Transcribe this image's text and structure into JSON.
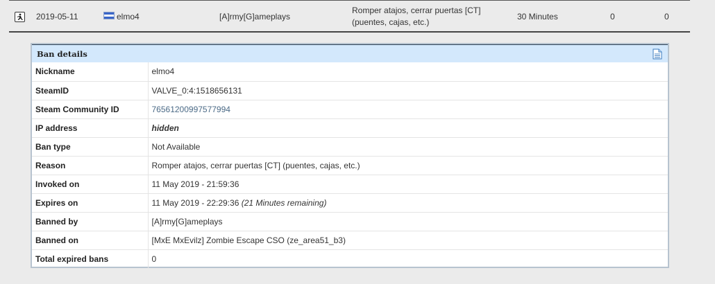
{
  "summary": {
    "date": "2019-05-11",
    "nickname": "elmo4",
    "admin": "[A]rmy[G]ameplays",
    "reason": "Romper atajos, cerrar puertas [CT] (puentes, cajas, etc.)",
    "length": "30 Minutes",
    "col_a": "0",
    "col_b": "0",
    "game_icon": "counter-strike-icon",
    "flag_icon": "country-flag-icon"
  },
  "details": {
    "header": "Ban details",
    "rows": [
      {
        "label": "Nickname",
        "value": "elmo4"
      },
      {
        "label": "SteamID",
        "value": "VALVE_0:4:1518656131"
      },
      {
        "label": "Steam Community ID",
        "value": "76561200997577994"
      },
      {
        "label": "IP address",
        "value": "hidden"
      },
      {
        "label": "Ban type",
        "value": "Not Available"
      },
      {
        "label": "Reason",
        "value": "Romper atajos, cerrar puertas [CT] (puentes, cajas, etc.)"
      },
      {
        "label": "Invoked on",
        "value": "11 May 2019 - 21:59:36"
      },
      {
        "label": "Expires on",
        "value": "11 May 2019 - 22:29:36",
        "extra": "(21 Minutes remaining)"
      },
      {
        "label": "Banned by",
        "value": "[A]rmy[G]ameplays"
      },
      {
        "label": "Banned on",
        "value": "[MxE MxEvilz] Zombie Escape CSO (ze_area51_b3)"
      },
      {
        "label": "Total expired bans",
        "value": "0"
      }
    ]
  },
  "colors": {
    "header_bg": "#d3e8fc",
    "link": "#4b6a86"
  }
}
